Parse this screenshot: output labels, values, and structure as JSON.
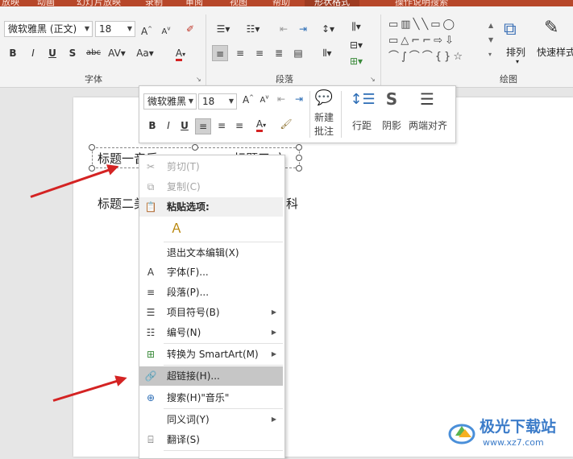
{
  "ribbon": {
    "tabs": [
      "放映",
      "动画",
      "幻灯片放映",
      "录制",
      "审阅",
      "视图",
      "帮助",
      "形状格式",
      "操作说明搜索"
    ],
    "font_name": "微软雅黑 (正文)",
    "font_size": "18",
    "groups": {
      "font": "字体",
      "paragraph": "段落",
      "drawing": "绘图"
    },
    "arrange_label": "排列",
    "quick_styles_label": "快速样式",
    "accent_color": "#b7472a",
    "font_color": "#d42323"
  },
  "mini_toolbar": {
    "font_name": "微软雅黑",
    "font_size": "18",
    "new_comment_line1": "新建",
    "new_comment_line2": "批注",
    "line_spacing": "行距",
    "shadow": "阴影",
    "justify": "两端对齐"
  },
  "slide": {
    "title1_left": "标题一音乐",
    "title1_right": "标题三 文",
    "title2_left": "标题二美",
    "title2_right": "科"
  },
  "context_menu": {
    "cut": "剪切(T)",
    "copy": "复制(C)",
    "paste_options": "粘贴选项:",
    "exit_edit": "退出文本编辑(X)",
    "font": "字体(F)...",
    "paragraph": "段落(P)...",
    "bullets": "项目符号(B)",
    "numbering": "编号(N)",
    "smartart": "转换为 SmartArt(M)",
    "hyperlink": "超链接(H)...",
    "search": "搜索(H)\"音乐\"",
    "synonyms": "同义词(Y)",
    "translate": "翻译(S)"
  },
  "watermark": {
    "name": "极光下载站",
    "url": "www.xz7.com"
  }
}
